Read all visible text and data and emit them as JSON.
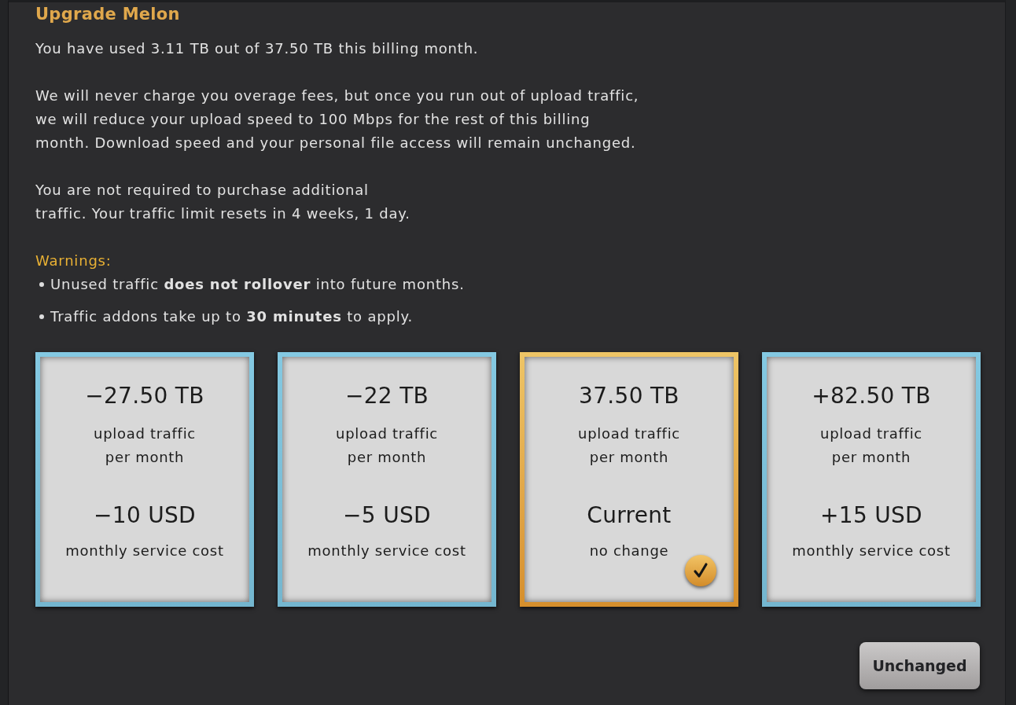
{
  "title": "Upgrade Melon",
  "paragraphs": [
    "You have used 3.11 TB out of 37.50 TB this billing month.",
    "We will never charge you overage fees, but once you run out of upload traffic, we will reduce your upload speed to 100 Mbps for the rest of this billing month. Download speed and your personal file access will remain unchanged.",
    "You are not required to purchase additional traffic. Your traffic limit resets in 4 weeks, 1 day."
  ],
  "warnings": {
    "heading": "Warnings:",
    "items": [
      "Unused traffic **does not rollover** into future months.",
      "Traffic addons take up to **30 minutes** to apply."
    ]
  },
  "plans": [
    {
      "traffic": "−27.50 TB",
      "traffic_label": [
        "upload traffic",
        "per month"
      ],
      "price": "−10 USD",
      "price_label": "monthly service cost",
      "selected": false
    },
    {
      "traffic": "−22 TB",
      "traffic_label": [
        "upload traffic",
        "per month"
      ],
      "price": "−5 USD",
      "price_label": "monthly service cost",
      "selected": false
    },
    {
      "traffic": "37.50 TB",
      "traffic_label": [
        "upload traffic",
        "per month"
      ],
      "price": "Current",
      "price_label": "no change",
      "selected": true
    },
    {
      "traffic": "+82.50 TB",
      "traffic_label": [
        "upload traffic",
        "per month"
      ],
      "price": "+15 USD",
      "price_label": "monthly service cost",
      "selected": false
    }
  ],
  "button": "Unchanged"
}
